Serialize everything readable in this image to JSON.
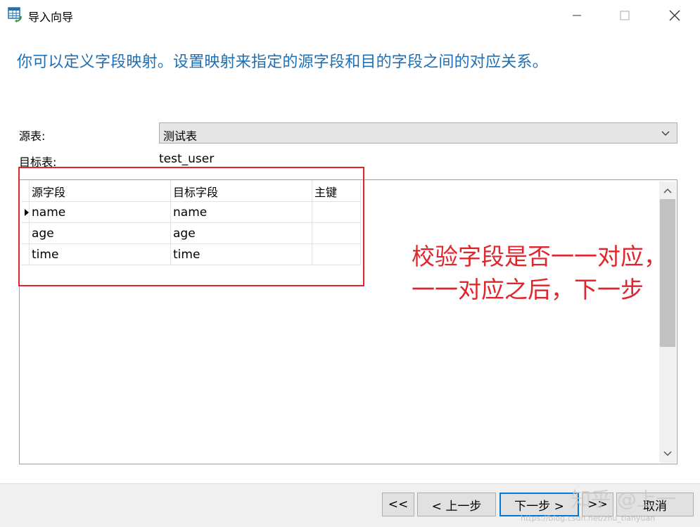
{
  "window": {
    "title": "导入向导",
    "icon": "table-import-icon",
    "controls": {
      "minimize": "—",
      "maximize": "☐",
      "close": "✕"
    }
  },
  "instruction": "你可以定义字段映射。设置映射来指定的源字段和目的字段之间的对应关系。",
  "source_table": {
    "label": "源表:",
    "value": "测试表"
  },
  "target_table": {
    "label": "目标表:",
    "value": "test_user"
  },
  "grid": {
    "columns": [
      "源字段",
      "目标字段",
      "主键"
    ],
    "rows": [
      {
        "source": "name",
        "target": "name",
        "primary_key": "",
        "current": true
      },
      {
        "source": "age",
        "target": "age",
        "primary_key": "",
        "current": false
      },
      {
        "source": "time",
        "target": "time",
        "primary_key": "",
        "current": false
      }
    ]
  },
  "annotation": {
    "line1": "校验字段是否一一对应，",
    "line2": "一一对应之后，下一步",
    "color": "#e0262c"
  },
  "buttons": {
    "first": "<<",
    "prev": "< 上一步",
    "next": "下一步 >",
    "last": ">>",
    "cancel": "取消"
  },
  "watermark": {
    "main": "知乎 @上一",
    "url": "https://blog.csdn.net/zhu_tianyuan"
  },
  "colors": {
    "accent": "#0078d7",
    "instruction_text": "#1f6fb4"
  }
}
